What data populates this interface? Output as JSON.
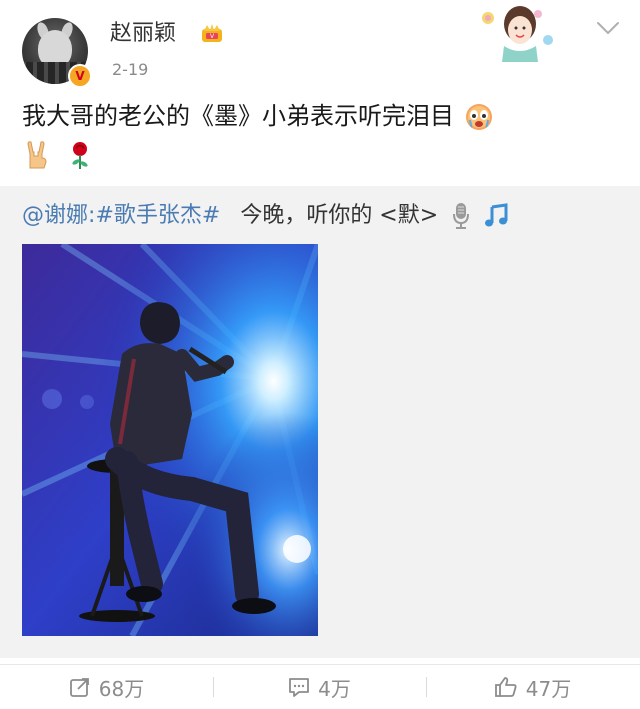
{
  "post": {
    "author": "赵丽颖",
    "verified_badge": "V",
    "date": "2-19",
    "text": "我大哥的老公的《墨》小弟表示听完泪目",
    "emojis": [
      "cry-face-icon",
      "rock-hand-icon",
      "rose-icon"
    ]
  },
  "repost": {
    "mention": "@谢娜",
    "colon": ":",
    "topic": "#歌手张杰#",
    "message": "今晚，听你的 <默>",
    "icons": [
      "microphone-icon",
      "music-note-icon"
    ]
  },
  "actions": {
    "repost_count": "68万",
    "comment_count": "4万",
    "like_count": "47万"
  },
  "colors": {
    "link": "#4a7bb2",
    "repost_bg": "#f2f2f2",
    "muted": "#8c8c8c",
    "badge": "#f5a623"
  }
}
